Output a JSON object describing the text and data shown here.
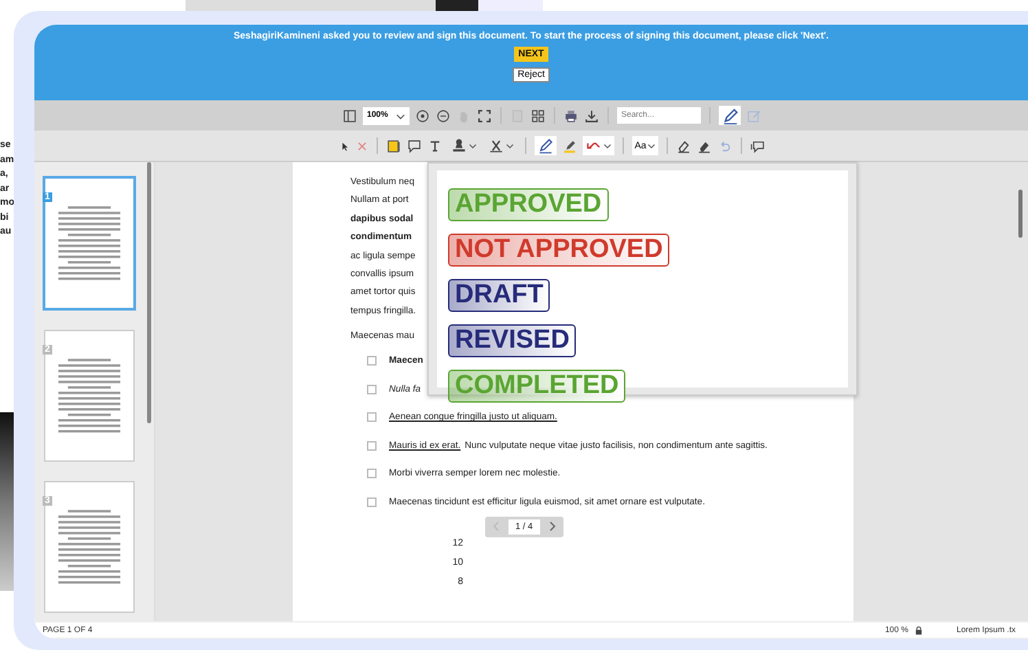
{
  "background": {
    "text_fragments": [
      "se",
      "am",
      "a,",
      "ar",
      "mo",
      "bi",
      "au"
    ]
  },
  "banner": {
    "message": "SeshagiriKamineni asked you to review and sign this document. To start the process of signing this document, please click 'Next'.",
    "next_button": "NEXT",
    "reject_button": "Reject"
  },
  "toolbar": {
    "zoom": "100%",
    "search": {
      "placeholder": "Search..."
    },
    "sign_selected": true
  },
  "annotation_toolbar": {
    "font_button": "Aa",
    "pen_selected": true
  },
  "thumbnails": [
    {
      "number": "1",
      "selected": true
    },
    {
      "number": "2",
      "selected": false
    },
    {
      "number": "3",
      "selected": false
    }
  ],
  "document": {
    "paragraph_lines": [
      {
        "text": "Vestibulum neq",
        "kind": "plain"
      },
      {
        "text": "Nullam at port",
        "kind": "plain"
      },
      {
        "text": "dapibus sodal",
        "kind": "strong"
      },
      {
        "text": "condimentum",
        "kind": "strong"
      },
      {
        "text": "ac ligula sempe",
        "kind": "plain"
      },
      {
        "text": "convallis ipsum",
        "kind": "plain"
      },
      {
        "text": "amet tortor quis",
        "kind": "plain"
      },
      {
        "text": "tempus fringilla.",
        "kind": "plain"
      }
    ],
    "paragraph_2": "Maecenas mau",
    "list_items": [
      {
        "checked": false,
        "parts": [
          {
            "text": "Maecen",
            "kind": "strong"
          }
        ]
      },
      {
        "checked": false,
        "parts": [
          {
            "text": "Nulla fa",
            "kind": "emphasis"
          }
        ]
      },
      {
        "checked": false,
        "parts": [
          {
            "text": "Aenean congue fringilla justo ut aliquam.",
            "kind": "link"
          }
        ]
      },
      {
        "checked": false,
        "parts": [
          {
            "text": "Mauris id ex erat.",
            "kind": "link"
          },
          {
            "text": "Nunc vulputate neque vitae justo facilisis, non condimentum ante sagittis.",
            "kind": "plain"
          }
        ]
      },
      {
        "checked": false,
        "parts": [
          {
            "text": "Morbi viverra semper lorem nec molestie.",
            "kind": "plain"
          }
        ]
      },
      {
        "checked": false,
        "parts": [
          {
            "text": "Maecenas tincidunt est efficitur ligula euismod, sit amet ornare est vulputate.",
            "kind": "plain"
          }
        ]
      }
    ],
    "pager": "1 / 4",
    "axis_labels": [
      "12",
      "10",
      "8"
    ]
  },
  "stamp_menu": [
    {
      "label": "APPROVED",
      "color": "#5aa532"
    },
    {
      "label": "NOT APPROVED",
      "color": "#d03a2c"
    },
    {
      "label": "DRAFT",
      "color": "#262b7a"
    },
    {
      "label": "REVISED",
      "color": "#262b7a"
    },
    {
      "label": "COMPLETED",
      "color": "#5aa532"
    }
  ],
  "status_bar": {
    "page": "PAGE 1 OF 4",
    "zoom": "100 %",
    "filename": "Lorem Ipsum .tx"
  }
}
